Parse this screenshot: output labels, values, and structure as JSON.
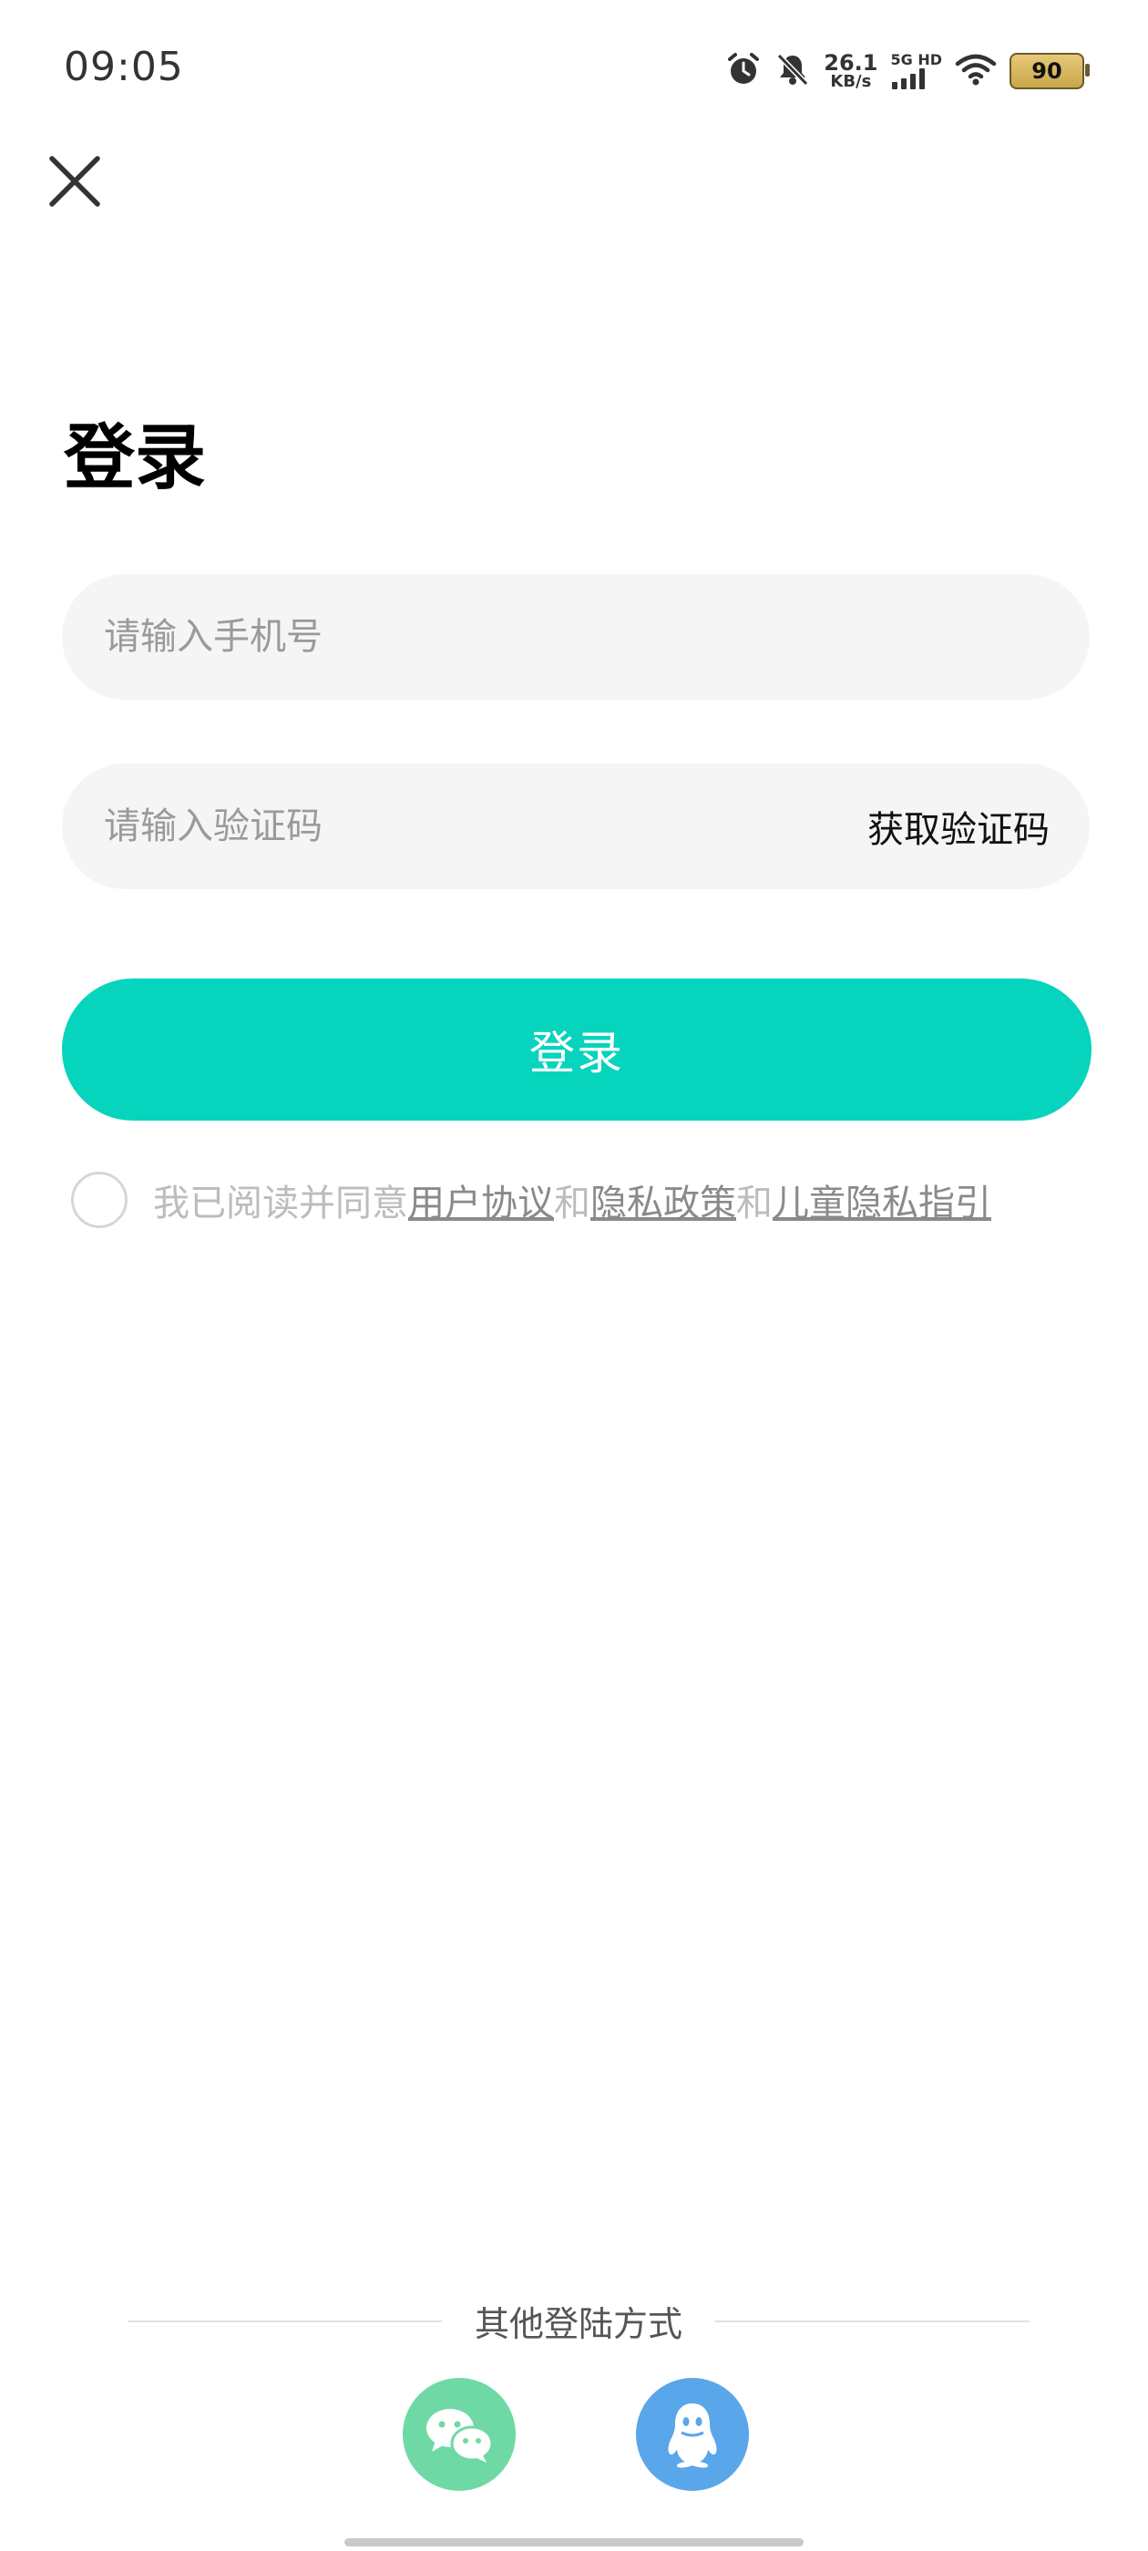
{
  "status_bar": {
    "time": "09:05",
    "net_speed_value": "26.1",
    "net_speed_unit": "KB/s",
    "network_type": "5G HD",
    "battery_level": "90",
    "icons": [
      "alarm-icon",
      "mute-icon",
      "signal-icon",
      "wifi-icon",
      "battery-icon"
    ]
  },
  "header": {
    "close_icon": "close-icon"
  },
  "title": "登录",
  "phone": {
    "placeholder": "请输入手机号",
    "value": ""
  },
  "code": {
    "placeholder": "请输入验证码",
    "value": "",
    "get_code_label": "获取验证码"
  },
  "login_button": {
    "label": "登录",
    "color": "#06d4bc"
  },
  "agreement": {
    "checked": false,
    "prefix": "我已阅读并同意",
    "link_user": "用户协议",
    "sep1": "和",
    "link_privacy": "隐私政策",
    "sep2": "和",
    "link_child": "儿童隐私指引"
  },
  "other_login": {
    "label": "其他登陆方式",
    "methods": [
      {
        "name": "wechat",
        "icon": "wechat-icon",
        "color": "#6fd9a5"
      },
      {
        "name": "qq",
        "icon": "qq-icon",
        "color": "#5aa6ea"
      }
    ]
  }
}
